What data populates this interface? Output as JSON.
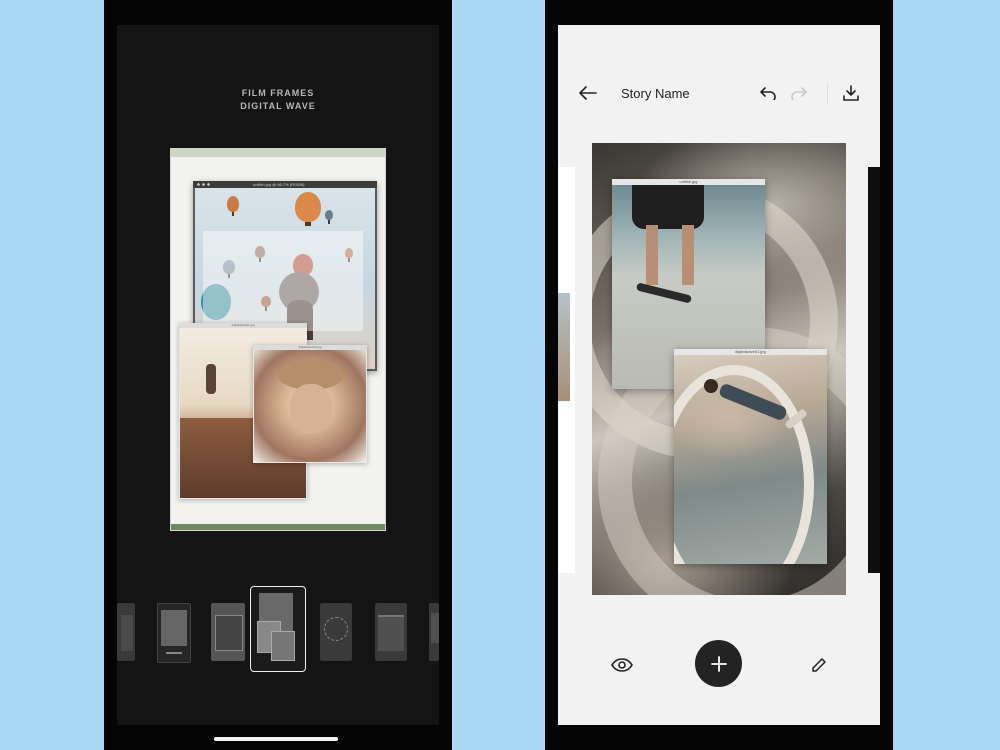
{
  "left_screen": {
    "header": {
      "line1": "FILM FRAMES",
      "line2": "DIGITAL WAVE"
    },
    "windows": {
      "top_title": "unifish.jpg @ 66.7% (RGB/8)",
      "mid_title": "digitalwave01.jpg",
      "front_title": "digitalwave02.jpg"
    },
    "template_strip": {
      "selected_index": 3,
      "count": 7
    }
  },
  "right_screen": {
    "topbar": {
      "title": "Story Name",
      "back_icon": "arrow-left-icon",
      "undo_icon": "undo-icon",
      "redo_icon": "redo-icon",
      "download_icon": "download-icon"
    },
    "windows": {
      "top_title": "unifish.jpg",
      "bottom_title": "digitalwave01.jpg"
    },
    "bottombar": {
      "preview_icon": "eye-icon",
      "add_icon": "plus-icon",
      "edit_icon": "pencil-icon"
    }
  },
  "colors": {
    "background": "#a9d8f5",
    "left_screen_bg": "#141414",
    "right_screen_bg": "#f2f2f2",
    "fab": "#232323"
  }
}
